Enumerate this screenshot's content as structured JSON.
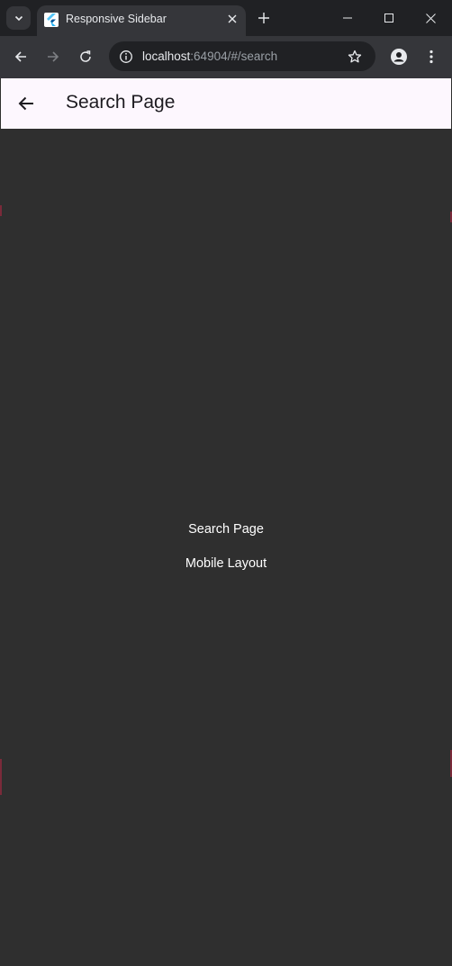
{
  "browser": {
    "tab": {
      "title": "Responsive Sidebar"
    },
    "address_bar": {
      "host": "localhost",
      "path": ":64904/#/search"
    }
  },
  "app": {
    "appbar": {
      "title": "Search Page"
    },
    "body": {
      "line1": "Search Page",
      "line2": "Mobile Layout"
    }
  },
  "colors": {
    "appbar_bg": "#fdf7fe",
    "page_bg": "#2f2f2f",
    "browser_frame": "#202124",
    "toolbar_bg": "#35363a"
  }
}
